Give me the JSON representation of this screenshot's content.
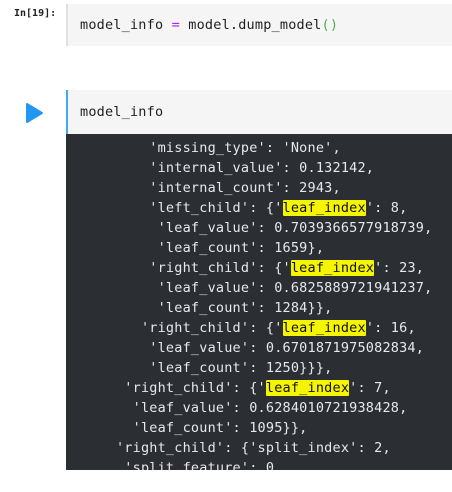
{
  "cell1": {
    "prompt": "In[19]:",
    "code_var": "model_info",
    "code_op": "=",
    "code_call": "model.dump_model",
    "code_parens": "()"
  },
  "cell2": {
    "code": "model_info"
  },
  "output": {
    "highlight_term": "leaf_index",
    "lines": [
      {
        "indent": "          ",
        "pre": "'missing_type': 'None',",
        "hl": "",
        "post": ""
      },
      {
        "indent": "          ",
        "pre": "'internal_value': 0.132142,",
        "hl": "",
        "post": ""
      },
      {
        "indent": "          ",
        "pre": "'internal_count': 2943,",
        "hl": "",
        "post": ""
      },
      {
        "indent": "          ",
        "pre": "'left_child': {'",
        "hl": "leaf_index",
        "post": "': 8,"
      },
      {
        "indent": "           ",
        "pre": "'leaf_value': 0.7039366577918739,",
        "hl": "",
        "post": ""
      },
      {
        "indent": "           ",
        "pre": "'leaf_count': 1659},",
        "hl": "",
        "post": ""
      },
      {
        "indent": "          ",
        "pre": "'right_child': {'",
        "hl": "leaf_index",
        "post": "': 23,"
      },
      {
        "indent": "           ",
        "pre": "'leaf_value': 0.6825889721941237,",
        "hl": "",
        "post": ""
      },
      {
        "indent": "           ",
        "pre": "'leaf_count': 1284}},",
        "hl": "",
        "post": ""
      },
      {
        "indent": "         ",
        "pre": "'right_child': {'",
        "hl": "leaf_index",
        "post": "': 16,"
      },
      {
        "indent": "          ",
        "pre": "'leaf_value': 0.6701871975082834,",
        "hl": "",
        "post": ""
      },
      {
        "indent": "          ",
        "pre": "'leaf_count': 1250}}},",
        "hl": "",
        "post": ""
      },
      {
        "indent": "       ",
        "pre": "'right_child': {'",
        "hl": "leaf_index",
        "post": "': 7,"
      },
      {
        "indent": "        ",
        "pre": "'leaf_value': 0.6284010721938428,",
        "hl": "",
        "post": ""
      },
      {
        "indent": "        ",
        "pre": "'leaf_count': 1095}},",
        "hl": "",
        "post": ""
      },
      {
        "indent": "      ",
        "pre": "'right_child': {'split_index': 2,",
        "hl": "",
        "post": ""
      },
      {
        "indent": "       ",
        "pre": "'split_feature': 0,",
        "hl": "",
        "post": ""
      }
    ]
  },
  "colors": {
    "cell_bg": "#f5f5f5",
    "active_border": "#42a5f5",
    "output_bg": "#2b2e33",
    "highlight": "#f5f500",
    "run_button": "#2196f3"
  },
  "icons": {
    "run": "play-icon"
  }
}
